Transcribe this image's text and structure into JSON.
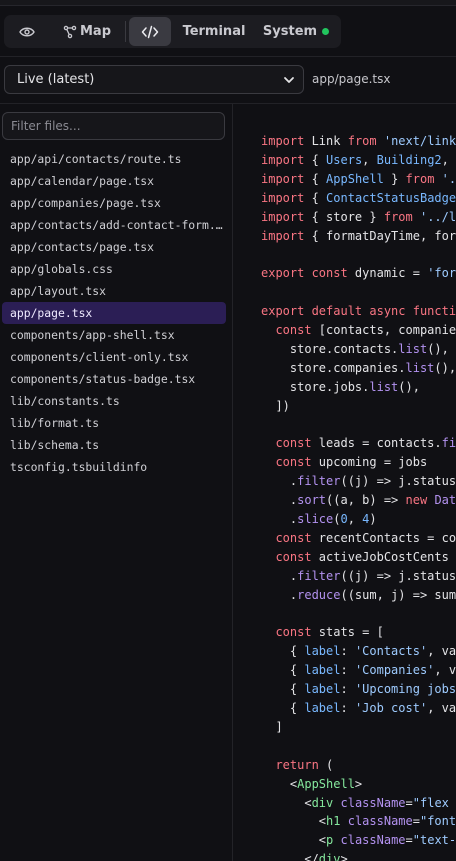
{
  "tabs": [
    {
      "id": "preview",
      "label": "",
      "icon": "eye-icon"
    },
    {
      "id": "map",
      "label": "Map",
      "icon": "map-icon"
    },
    {
      "id": "code",
      "label": "",
      "icon": "code-icon",
      "active": true
    },
    {
      "id": "terminal",
      "label": "Terminal"
    },
    {
      "id": "system",
      "label": "System",
      "status_color": "#22c55e"
    }
  ],
  "version_select": {
    "value": "Live (latest)"
  },
  "current_path": "app/page.tsx",
  "filter": {
    "placeholder": "Filter files..."
  },
  "files": [
    "app/api/contacts/route.ts",
    "app/calendar/page.tsx",
    "app/companies/page.tsx",
    "app/contacts/add-contact-form.tsx",
    "app/contacts/page.tsx",
    "app/globals.css",
    "app/layout.tsx",
    "app/page.tsx",
    "components/app-shell.tsx",
    "components/client-only.tsx",
    "components/status-badge.tsx",
    "lib/constants.ts",
    "lib/format.ts",
    "lib/schema.ts",
    "tsconfig.tsbuildinfo"
  ],
  "selected_file": "app/page.tsx",
  "code_lines": [
    [
      [
        "kw",
        "import"
      ],
      [
        "p",
        " Link "
      ],
      [
        "kw",
        "from"
      ],
      [
        "str",
        " 'next/link'"
      ]
    ],
    [
      [
        "kw",
        "import"
      ],
      [
        "p",
        " { "
      ],
      [
        "var",
        "Users"
      ],
      [
        "p",
        ", "
      ],
      [
        "var",
        "Building2"
      ],
      [
        "p",
        ", Ca"
      ]
    ],
    [
      [
        "kw",
        "import"
      ],
      [
        "p",
        " { "
      ],
      [
        "var",
        "AppShell"
      ],
      [
        "p",
        " } "
      ],
      [
        "kw",
        "from"
      ],
      [
        "str",
        " '../"
      ]
    ],
    [
      [
        "kw",
        "import"
      ],
      [
        "p",
        " { "
      ],
      [
        "var",
        "ContactStatusBadge"
      ],
      [
        "p",
        ","
      ]
    ],
    [
      [
        "kw",
        "import"
      ],
      [
        "p",
        " { store } "
      ],
      [
        "kw",
        "from"
      ],
      [
        "str",
        " '../lib"
      ]
    ],
    [
      [
        "kw",
        "import"
      ],
      [
        "p",
        " { formatDayTime, forma"
      ]
    ],
    [],
    [
      [
        "kw",
        "export const"
      ],
      [
        "p",
        " dynamic = "
      ],
      [
        "str",
        "'force"
      ]
    ],
    [],
    [
      [
        "kw",
        "export default async function"
      ]
    ],
    [
      [
        "p",
        "  "
      ],
      [
        "kw",
        "const"
      ],
      [
        "p",
        " [contacts, companies,"
      ]
    ],
    [
      [
        "p",
        "    store.contacts."
      ],
      [
        "fn",
        "list"
      ],
      [
        "p",
        "(),"
      ]
    ],
    [
      [
        "p",
        "    store.companies."
      ],
      [
        "fn",
        "list"
      ],
      [
        "p",
        "(),"
      ]
    ],
    [
      [
        "p",
        "    store.jobs."
      ],
      [
        "fn",
        "list"
      ],
      [
        "p",
        "(),"
      ]
    ],
    [
      [
        "p",
        "  ])"
      ]
    ],
    [],
    [
      [
        "p",
        "  "
      ],
      [
        "kw",
        "const"
      ],
      [
        "p",
        " leads = contacts."
      ],
      [
        "fn",
        "filt"
      ]
    ],
    [
      [
        "p",
        "  "
      ],
      [
        "kw",
        "const"
      ],
      [
        "p",
        " upcoming = jobs"
      ]
    ],
    [
      [
        "p",
        "    ."
      ],
      [
        "fn",
        "filter"
      ],
      [
        "p",
        "((j) => j.status ="
      ]
    ],
    [
      [
        "p",
        "    ."
      ],
      [
        "fn",
        "sort"
      ],
      [
        "p",
        "((a, b) => "
      ],
      [
        "kw",
        "new"
      ],
      [
        "p",
        " "
      ],
      [
        "fn",
        "Date"
      ],
      [
        "p",
        "("
      ]
    ],
    [
      [
        "p",
        "    ."
      ],
      [
        "fn",
        "slice"
      ],
      [
        "p",
        "("
      ],
      [
        "var",
        "0"
      ],
      [
        "p",
        ", "
      ],
      [
        "var",
        "4"
      ],
      [
        "p",
        ")"
      ]
    ],
    [
      [
        "p",
        "  "
      ],
      [
        "kw",
        "const"
      ],
      [
        "p",
        " recentContacts = cont"
      ]
    ],
    [
      [
        "p",
        "  "
      ],
      [
        "kw",
        "const"
      ],
      [
        "p",
        " activeJobCostCents ="
      ]
    ],
    [
      [
        "p",
        "    ."
      ],
      [
        "fn",
        "filter"
      ],
      [
        "p",
        "((j) => j.status ="
      ]
    ],
    [
      [
        "p",
        "    ."
      ],
      [
        "fn",
        "reduce"
      ],
      [
        "p",
        "((sum, j) => sum +"
      ]
    ],
    [],
    [
      [
        "p",
        "  "
      ],
      [
        "kw",
        "const"
      ],
      [
        "p",
        " stats = ["
      ]
    ],
    [
      [
        "p",
        "    { "
      ],
      [
        "var",
        "label"
      ],
      [
        "p",
        ": "
      ],
      [
        "str",
        "'Contacts'"
      ],
      [
        "p",
        ", valu"
      ]
    ],
    [
      [
        "p",
        "    { "
      ],
      [
        "var",
        "label"
      ],
      [
        "p",
        ": "
      ],
      [
        "str",
        "'Companies'"
      ],
      [
        "p",
        ", val"
      ]
    ],
    [
      [
        "p",
        "    { "
      ],
      [
        "var",
        "label"
      ],
      [
        "p",
        ": "
      ],
      [
        "str",
        "'Upcoming jobs'"
      ],
      [
        "p",
        ","
      ]
    ],
    [
      [
        "p",
        "    { "
      ],
      [
        "var",
        "label"
      ],
      [
        "p",
        ": "
      ],
      [
        "str",
        "'Job cost'"
      ],
      [
        "p",
        ", valu"
      ]
    ],
    [
      [
        "p",
        "  ]"
      ]
    ],
    [],
    [
      [
        "p",
        "  "
      ],
      [
        "kw",
        "return"
      ],
      [
        "p",
        " ("
      ]
    ],
    [
      [
        "p",
        "    <"
      ],
      [
        "jsx",
        "AppShell"
      ],
      [
        "p",
        ">"
      ]
    ],
    [
      [
        "p",
        "      <"
      ],
      [
        "jsx",
        "div"
      ],
      [
        "p",
        " "
      ],
      [
        "attr",
        "className"
      ],
      [
        "p",
        "="
      ],
      [
        "str",
        "\"flex fl"
      ]
    ],
    [
      [
        "p",
        "        <"
      ],
      [
        "jsx",
        "h1"
      ],
      [
        "p",
        " "
      ],
      [
        "attr",
        "className"
      ],
      [
        "p",
        "="
      ],
      [
        "str",
        "\"font-s"
      ]
    ],
    [
      [
        "p",
        "        <"
      ],
      [
        "jsx",
        "p"
      ],
      [
        "p",
        " "
      ],
      [
        "attr",
        "className"
      ],
      [
        "p",
        "="
      ],
      [
        "str",
        "\"text-mu"
      ]
    ],
    [
      [
        "p",
        "      </"
      ],
      [
        "jsx",
        "div"
      ],
      [
        "p",
        ">"
      ]
    ]
  ]
}
